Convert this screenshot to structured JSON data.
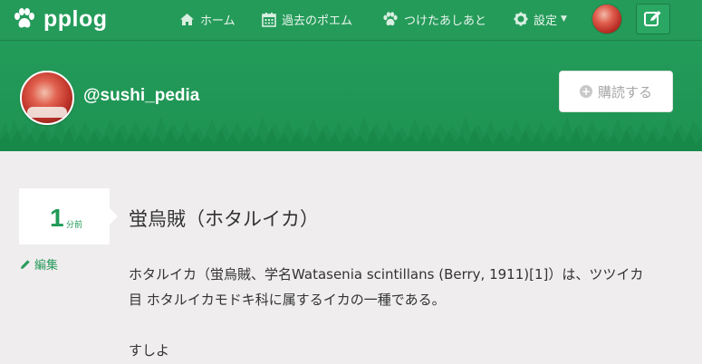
{
  "navbar": {
    "brand": "pplog",
    "items": [
      {
        "label": "ホーム",
        "icon": "home-icon"
      },
      {
        "label": "過去のポエム",
        "icon": "calendar-icon"
      },
      {
        "label": "つけたあしあと",
        "icon": "paw-icon"
      },
      {
        "label": "設定",
        "icon": "gear-icon"
      }
    ]
  },
  "profile": {
    "username": "@sushi_pedia",
    "subscribe_label": "購読する"
  },
  "post": {
    "time_value": "1",
    "time_unit": "分前",
    "edit_label": "編集",
    "title": "蛍烏賊（ホタルイカ）",
    "body_line1": "ホタルイカ（蛍烏賊、学名Watasenia scintillans (Berry, 1911)[1]）は、ツツイカ",
    "body_line2": "目 ホタルイカモドキ科に属するイカの一種である。",
    "body_line3": "すしよ"
  },
  "colors": {
    "brand_green": "#259b5a",
    "header_green": "#1e9353",
    "accent_green": "#1f9a56",
    "background": "#efedee"
  }
}
